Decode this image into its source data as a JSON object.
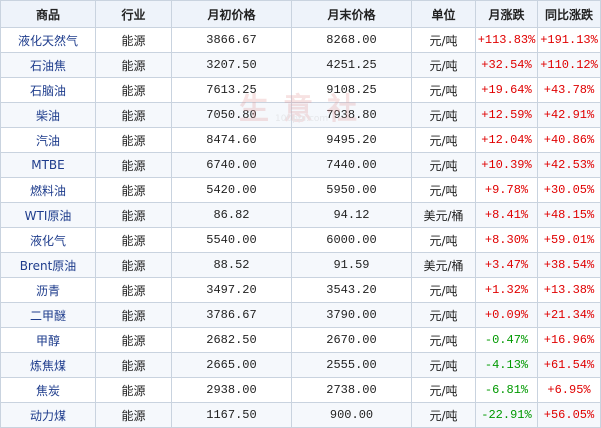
{
  "columns": [
    "商品",
    "行业",
    "月初价格",
    "月末价格",
    "单位",
    "月涨跌",
    "同比涨跌"
  ],
  "rows": [
    {
      "name": "液化天然气",
      "industry": "能源",
      "start": "3866.67",
      "end": "8268.00",
      "unit": "元/吨",
      "mom": "+113.83%",
      "yoy": "+191.13%",
      "mom_dir": "up",
      "yoy_dir": "up"
    },
    {
      "name": "石油焦",
      "industry": "能源",
      "start": "3207.50",
      "end": "4251.25",
      "unit": "元/吨",
      "mom": "+32.54%",
      "yoy": "+110.12%",
      "mom_dir": "up",
      "yoy_dir": "up"
    },
    {
      "name": "石脑油",
      "industry": "能源",
      "start": "7613.25",
      "end": "9108.25",
      "unit": "元/吨",
      "mom": "+19.64%",
      "yoy": "+43.78%",
      "mom_dir": "up",
      "yoy_dir": "up"
    },
    {
      "name": "柴油",
      "industry": "能源",
      "start": "7050.80",
      "end": "7938.80",
      "unit": "元/吨",
      "mom": "+12.59%",
      "yoy": "+42.91%",
      "mom_dir": "up",
      "yoy_dir": "up"
    },
    {
      "name": "汽油",
      "industry": "能源",
      "start": "8474.60",
      "end": "9495.20",
      "unit": "元/吨",
      "mom": "+12.04%",
      "yoy": "+40.86%",
      "mom_dir": "up",
      "yoy_dir": "up"
    },
    {
      "name": "MTBE",
      "industry": "能源",
      "start": "6740.00",
      "end": "7440.00",
      "unit": "元/吨",
      "mom": "+10.39%",
      "yoy": "+42.53%",
      "mom_dir": "up",
      "yoy_dir": "up"
    },
    {
      "name": "燃料油",
      "industry": "能源",
      "start": "5420.00",
      "end": "5950.00",
      "unit": "元/吨",
      "mom": "+9.78%",
      "yoy": "+30.05%",
      "mom_dir": "up",
      "yoy_dir": "up"
    },
    {
      "name": "WTI原油",
      "industry": "能源",
      "start": "86.82",
      "end": "94.12",
      "unit": "美元/桶",
      "mom": "+8.41%",
      "yoy": "+48.15%",
      "mom_dir": "up",
      "yoy_dir": "up"
    },
    {
      "name": "液化气",
      "industry": "能源",
      "start": "5540.00",
      "end": "6000.00",
      "unit": "元/吨",
      "mom": "+8.30%",
      "yoy": "+59.01%",
      "mom_dir": "up",
      "yoy_dir": "up"
    },
    {
      "name": "Brent原油",
      "industry": "能源",
      "start": "88.52",
      "end": "91.59",
      "unit": "美元/桶",
      "mom": "+3.47%",
      "yoy": "+38.54%",
      "mom_dir": "up",
      "yoy_dir": "up"
    },
    {
      "name": "沥青",
      "industry": "能源",
      "start": "3497.20",
      "end": "3543.20",
      "unit": "元/吨",
      "mom": "+1.32%",
      "yoy": "+13.38%",
      "mom_dir": "up",
      "yoy_dir": "up"
    },
    {
      "name": "二甲醚",
      "industry": "能源",
      "start": "3786.67",
      "end": "3790.00",
      "unit": "元/吨",
      "mom": "+0.09%",
      "yoy": "+21.34%",
      "mom_dir": "up",
      "yoy_dir": "up"
    },
    {
      "name": "甲醇",
      "industry": "能源",
      "start": "2682.50",
      "end": "2670.00",
      "unit": "元/吨",
      "mom": "-0.47%",
      "yoy": "+16.96%",
      "mom_dir": "down",
      "yoy_dir": "up"
    },
    {
      "name": "炼焦煤",
      "industry": "能源",
      "start": "2665.00",
      "end": "2555.00",
      "unit": "元/吨",
      "mom": "-4.13%",
      "yoy": "+61.54%",
      "mom_dir": "down",
      "yoy_dir": "up"
    },
    {
      "name": "焦炭",
      "industry": "能源",
      "start": "2938.00",
      "end": "2738.00",
      "unit": "元/吨",
      "mom": "-6.81%",
      "yoy": "+6.95%",
      "mom_dir": "down",
      "yoy_dir": "up"
    },
    {
      "name": "动力煤",
      "industry": "能源",
      "start": "1167.50",
      "end": "900.00",
      "unit": "元/吨",
      "mom": "-22.91%",
      "yoy": "+56.05%",
      "mom_dir": "down",
      "yoy_dir": "up"
    }
  ],
  "watermark": {
    "text": "生意社",
    "url": "100ppi.com"
  },
  "colors": {
    "up": "#e00000",
    "down": "#009900",
    "name": "#1e3c8c",
    "header_bg": "#eef3fa",
    "border": "#c9d3df"
  }
}
